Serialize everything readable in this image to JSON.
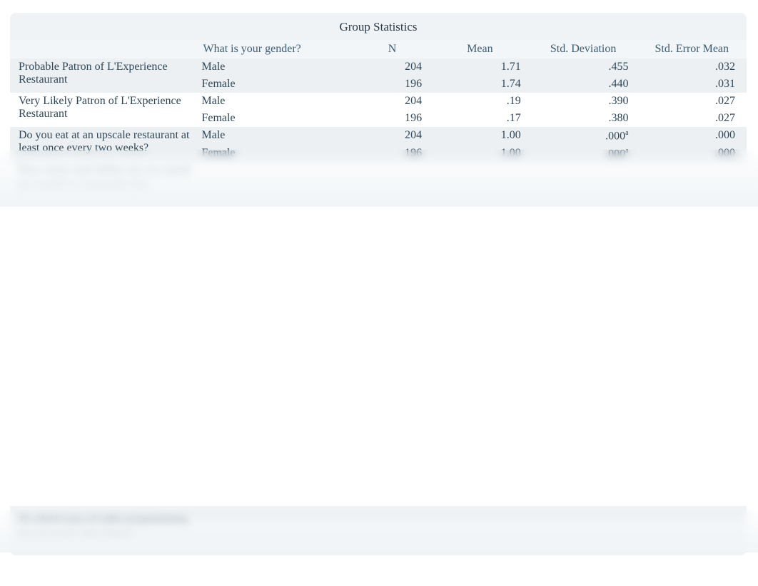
{
  "title": "Group Statistics",
  "headers": {
    "question": "",
    "gender": "What is your gender?",
    "n": "N",
    "mean": "Mean",
    "sd": "Std. Deviation",
    "sem": "Std. Error Mean"
  },
  "rows": [
    {
      "question": "Probable Patron of L'Experience Restaurant",
      "sub": [
        {
          "g": "Male",
          "n": "204",
          "mean": "1.71",
          "sd": ".455",
          "sem": ".032"
        },
        {
          "g": "Female",
          "n": "196",
          "mean": "1.74",
          "sd": ".440",
          "sem": ".031"
        }
      ]
    },
    {
      "question": "Very Likely Patron of L'Experience Restaurant",
      "sub": [
        {
          "g": "Male",
          "n": "204",
          "mean": ".19",
          "sd": ".390",
          "sem": ".027"
        },
        {
          "g": "Female",
          "n": "196",
          "mean": ".17",
          "sd": ".380",
          "sem": ".027"
        }
      ]
    },
    {
      "question": "Do you eat at an upscale restaurant at least once every two weeks?",
      "sub": [
        {
          "g": "Male",
          "n": "204",
          "mean": "1.00",
          "sd": ".000",
          "sd_sup": "a",
          "sem": ".000"
        },
        {
          "g": "Female",
          "n": "196",
          "mean": "1.00",
          "sd": ".000",
          "sd_sup": "a",
          "sem": ".000"
        }
      ]
    },
    {
      "question": "How many total dollars do you spend per month in restaurants (for",
      "sub": [
        {
          "g": "",
          "n": "",
          "mean": "",
          "sd": "",
          "sem": ""
        }
      ]
    }
  ],
  "bottom_question": "To which type of radio programming do you most often listen?"
}
